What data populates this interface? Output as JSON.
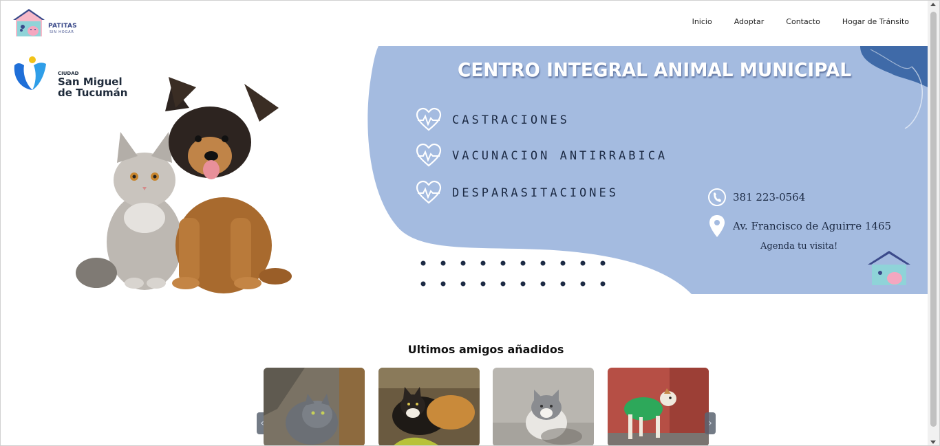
{
  "header": {
    "logo_text": "PATITAS",
    "logo_sub": "SIN HOGAR",
    "nav": [
      {
        "label": "Inicio"
      },
      {
        "label": "Adoptar"
      },
      {
        "label": "Contacto"
      },
      {
        "label": "Hogar de Tránsito"
      }
    ]
  },
  "banner": {
    "city_small": "CIUDAD",
    "city_line1": "San Miguel",
    "city_line2": "de Tucumán",
    "title": "CENTRO INTEGRAL ANIMAL MUNICIPAL",
    "services": [
      "CASTRACIONES",
      "VACUNACION ANTIRRABICA",
      "DESPARASITACIONES"
    ],
    "phone": "381 223-0564",
    "address": "Av. Francisco de Aguirre 1465",
    "agenda": "Agenda tu visita!",
    "colors": {
      "blue": "#a4bbe0",
      "dark_blue": "#3f6aa8",
      "text": "#1c2a44"
    }
  },
  "section": {
    "title": "Ultimos amigos añadidos",
    "cards": [
      {
        "alt": "gray-cat-photo"
      },
      {
        "alt": "calico-cat-photo"
      },
      {
        "alt": "gray-white-cat-photo"
      },
      {
        "alt": "dog-green-shirt-photo"
      }
    ]
  },
  "icons": {
    "prev": "chevron-left-icon",
    "next": "chevron-right-icon"
  }
}
